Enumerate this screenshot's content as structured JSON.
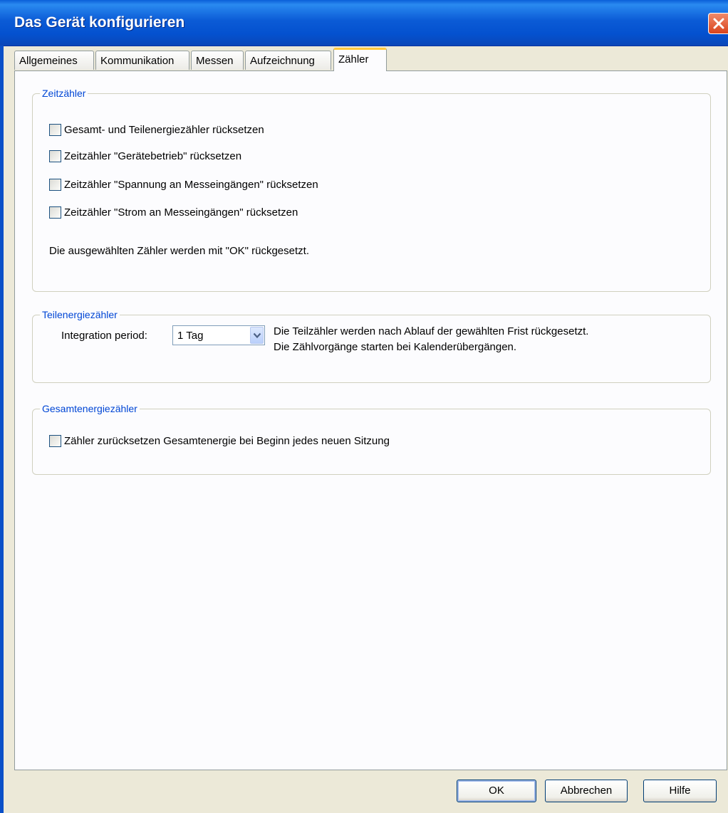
{
  "window": {
    "title": "Das Gerät konfigurieren",
    "close_icon": "close-icon"
  },
  "tabs": [
    {
      "label": "Allgemeines",
      "active": false
    },
    {
      "label": "Kommunikation",
      "active": false
    },
    {
      "label": "Messen",
      "active": false
    },
    {
      "label": "Aufzeichnung",
      "active": false
    },
    {
      "label": "Zähler",
      "active": true
    }
  ],
  "zeitzaehler": {
    "legend": "Zeitzähler",
    "options": [
      {
        "label": "Gesamt- und Teilenergiezähler rücksetzen",
        "checked": false
      },
      {
        "label": "Zeitzähler \"Gerätebetrieb\" rücksetzen",
        "checked": false
      },
      {
        "label": "Zeitzähler \"Spannung an Messeingängen\" rücksetzen",
        "checked": false
      },
      {
        "label": "Zeitzähler \"Strom an Messeingängen\" rücksetzen",
        "checked": false
      }
    ],
    "note": "Die ausgewählten Zähler werden mit \"OK\" rückgesetzt."
  },
  "teilenergie": {
    "legend": "Teilenergiezähler",
    "period_label": "Integration period:",
    "period_value": "1 Tag",
    "desc_line1": "Die Teilzähler werden nach Ablauf der gewählten Frist rückgesetzt.",
    "desc_line2": "Die Zählvorgänge starten bei Kalenderübergängen."
  },
  "gesamtenergie": {
    "legend": "Gesamtenergiezähler",
    "option": {
      "label": "Zähler zurücksetzen Gesamtenergie bei Beginn jedes neuen Sitzung",
      "checked": false
    }
  },
  "buttons": {
    "ok": "OK",
    "cancel": "Abbrechen",
    "help": "Hilfe"
  },
  "colors": {
    "title_bar": "#0b5bd6",
    "group_legend": "#0046d5",
    "active_tab_accent": "#ffc83c",
    "close_button": "#d9431c"
  }
}
